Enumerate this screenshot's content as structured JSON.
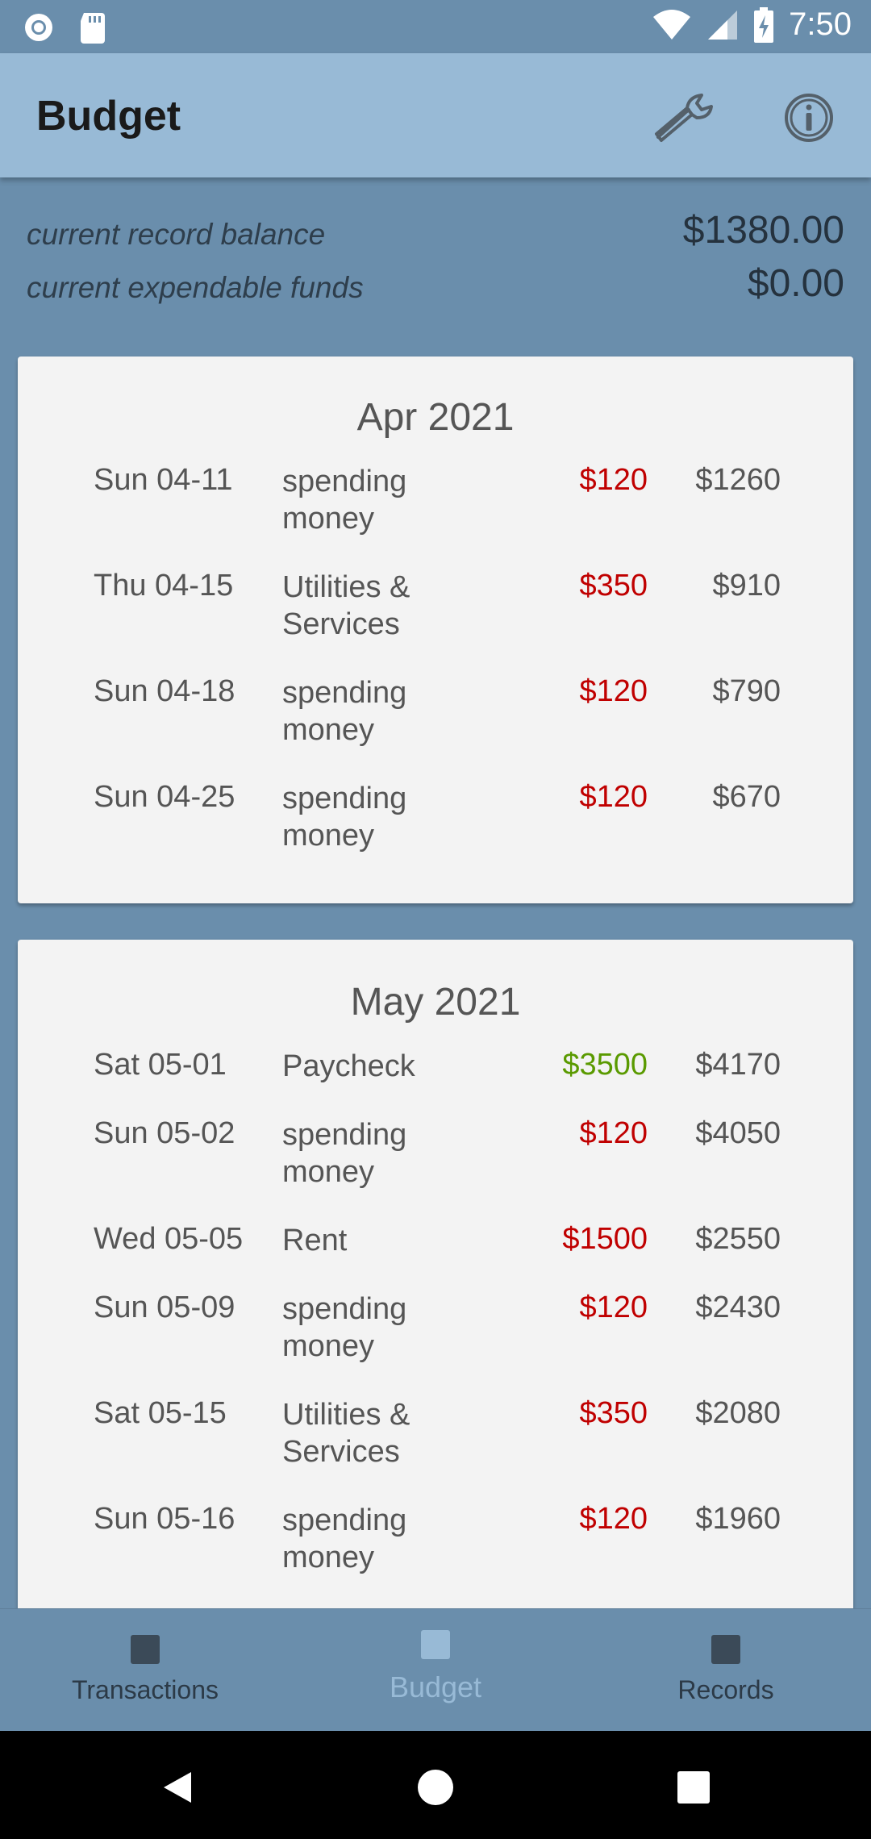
{
  "status_bar": {
    "time": "7:50",
    "icons": [
      "record-icon",
      "sd-card-icon",
      "wifi-icon",
      "cell-signal-icon",
      "battery-charging-icon"
    ]
  },
  "app_bar": {
    "title": "Budget",
    "actions": [
      "wrench-icon",
      "info-icon"
    ]
  },
  "summary": {
    "balance_label": "current record balance",
    "balance_value": "$1380.00",
    "funds_label": "current expendable funds",
    "funds_value": "$0.00"
  },
  "months": [
    {
      "title": "Apr 2021",
      "rows": [
        {
          "date": "Sun 04-11",
          "desc": "spending money",
          "amount": "$120",
          "type": "neg",
          "balance": "$1260"
        },
        {
          "date": "Thu 04-15",
          "desc": "Utilities & Services",
          "amount": "$350",
          "type": "neg",
          "balance": "$910"
        },
        {
          "date": "Sun 04-18",
          "desc": "spending money",
          "amount": "$120",
          "type": "neg",
          "balance": "$790"
        },
        {
          "date": "Sun 04-25",
          "desc": "spending money",
          "amount": "$120",
          "type": "neg",
          "balance": "$670"
        }
      ]
    },
    {
      "title": "May 2021",
      "rows": [
        {
          "date": "Sat 05-01",
          "desc": "Paycheck",
          "amount": "$3500",
          "type": "pos",
          "balance": "$4170"
        },
        {
          "date": "Sun 05-02",
          "desc": "spending money",
          "amount": "$120",
          "type": "neg",
          "balance": "$4050"
        },
        {
          "date": "Wed 05-05",
          "desc": "Rent",
          "amount": "$1500",
          "type": "neg",
          "balance": "$2550"
        },
        {
          "date": "Sun 05-09",
          "desc": "spending money",
          "amount": "$120",
          "type": "neg",
          "balance": "$2430"
        },
        {
          "date": "Sat 05-15",
          "desc": "Utilities & Services",
          "amount": "$350",
          "type": "neg",
          "balance": "$2080"
        },
        {
          "date": "Sun 05-16",
          "desc": "spending money",
          "amount": "$120",
          "type": "neg",
          "balance": "$1960"
        }
      ]
    }
  ],
  "bottom_nav": {
    "items": [
      {
        "label": "Transactions"
      },
      {
        "label": "Budget"
      },
      {
        "label": "Records"
      }
    ],
    "active": "Budget"
  },
  "colors": {
    "negative": "#c00000",
    "positive": "#5a9a00",
    "app_bar": "#98bad6",
    "background": "#6a8eac"
  }
}
